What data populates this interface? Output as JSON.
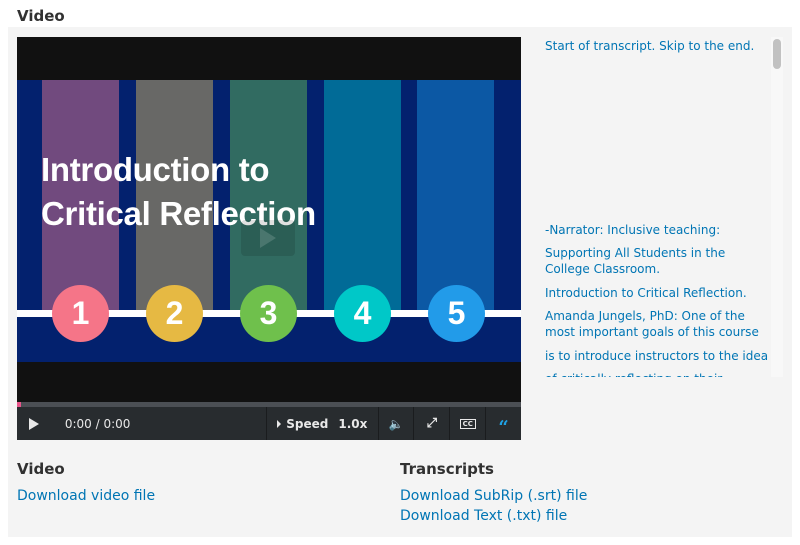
{
  "section_title": "Video",
  "slide": {
    "title_line1": "Introduction to",
    "title_line2": "Critical Reflection",
    "numbers": [
      "1",
      "2",
      "3",
      "4",
      "5"
    ],
    "stripe_colors": [
      "#714a7e",
      "#686866",
      "#316b61",
      "#016b97",
      "#0c58a4"
    ],
    "circle_colors": [
      "#f57588",
      "#e6b943",
      "#6fc04c",
      "#00c8c8",
      "#229be9"
    ],
    "background_color": "#03216e"
  },
  "controls": {
    "time": "0:00 / 0:00",
    "speed_label": "Speed",
    "speed_value": "1.0x",
    "progress": 0
  },
  "transcript": {
    "skip_link": "Start of transcript. Skip to the end.",
    "lines": [
      "-Narrator: Inclusive teaching:",
      "Supporting All Students in the College Classroom.",
      "Introduction to Critical Reflection.",
      "Amanda Jungels, PhD: One of the most important goals of this course",
      "is to introduce instructors to the idea",
      "of critically reflecting on their teaching"
    ]
  },
  "downloads": {
    "video_heading": "Video",
    "video_link": "Download video file",
    "transcripts_heading": "Transcripts",
    "srt_link": "Download SubRip (.srt) file",
    "txt_link": "Download Text (.txt) file"
  }
}
